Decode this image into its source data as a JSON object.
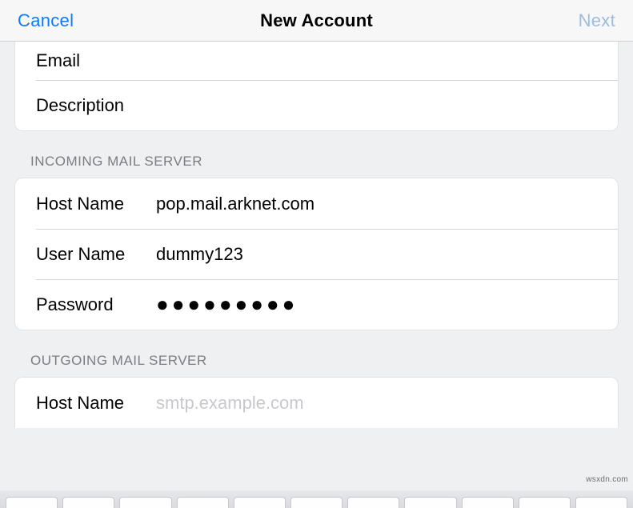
{
  "nav": {
    "cancel": "Cancel",
    "title": "New Account",
    "next": "Next"
  },
  "account": {
    "email_label": "Email",
    "email_value": "",
    "description_label": "Description",
    "description_value": ""
  },
  "incoming": {
    "header": "INCOMING MAIL SERVER",
    "host_label": "Host Name",
    "host_value": "pop.mail.arknet.com",
    "user_label": "User Name",
    "user_value": "dummy123",
    "password_label": "Password",
    "password_value": "●●●●●●●●●"
  },
  "outgoing": {
    "header": "OUTGOING MAIL SERVER",
    "host_label": "Host Name",
    "host_value": "",
    "host_placeholder": "smtp.example.com"
  },
  "watermark": "wsxdn.com"
}
